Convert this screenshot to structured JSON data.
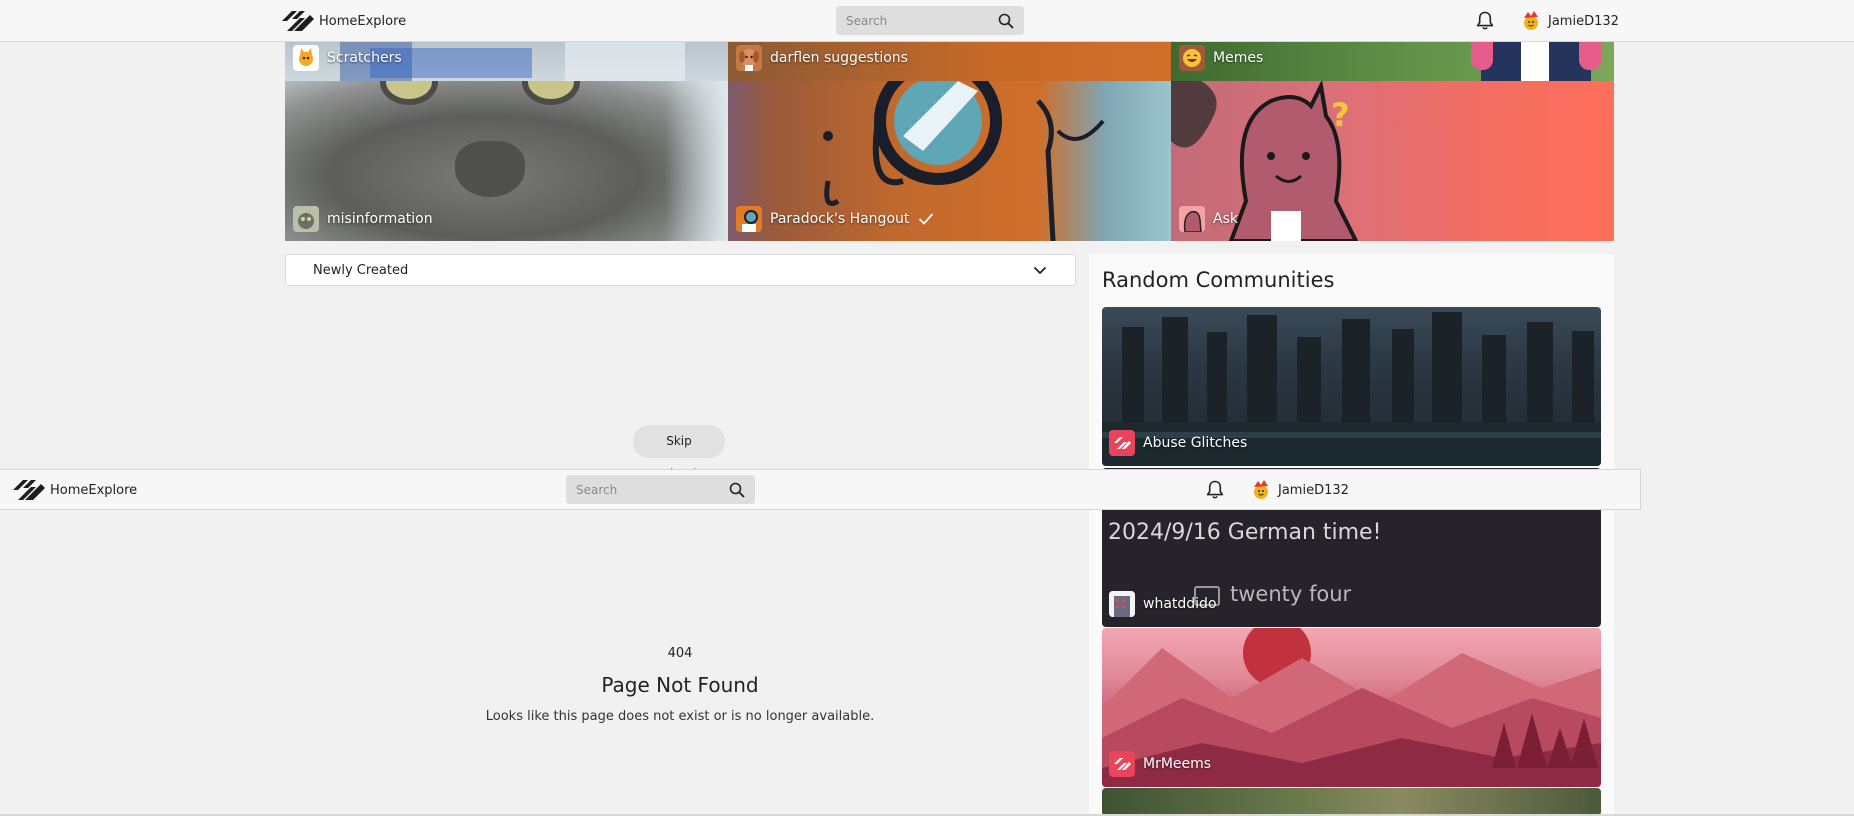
{
  "header": {
    "brand": "HomeExplore",
    "search_placeholder": "Search",
    "username": "JamieD132"
  },
  "featured": {
    "top_row": [
      {
        "name": "Scratchers",
        "icon": "scratch-cat-icon"
      },
      {
        "name": "darflen suggestions",
        "icon": "dog-avatar-icon"
      },
      {
        "name": "Memes",
        "icon": "laughing-face-icon"
      }
    ],
    "bottom_row": [
      {
        "name": "misinformation",
        "icon": "cat-avatar-icon"
      },
      {
        "name": "Paradock's Hangout",
        "icon": "paradock-avatar-icon",
        "verified": true
      },
      {
        "name": "Ask",
        "icon": "pink-creature-icon"
      }
    ]
  },
  "sort": {
    "selected": "Newly Created"
  },
  "random_communities": {
    "title": "Random Communities",
    "items": [
      {
        "name": "Abuse Glitches",
        "icon": "darflen-logo-icon"
      },
      {
        "name": "whatddido",
        "icon": "building-avatar-icon",
        "banner_text_1": "2024/9/16 German time!",
        "banner_text_2": "twenty four"
      },
      {
        "name": "MrMeems",
        "icon": "darflen-logo-icon"
      }
    ]
  },
  "skip_navigation": "Skip Navigation",
  "navbar2": {
    "brand": "HomeExplore",
    "search_placeholder": "Search",
    "username": "JamieD132"
  },
  "not_found": {
    "code": "404",
    "title": "Page Not Found",
    "message": "Looks like this page does not exist or is no longer available."
  },
  "colors": {
    "page_bg": "#f1f1f1",
    "bar_bg": "#f7f7f7",
    "search_bg": "#dedede",
    "ask_gradient_end": "#ff6f5a",
    "brand_red": "#e8445c"
  }
}
